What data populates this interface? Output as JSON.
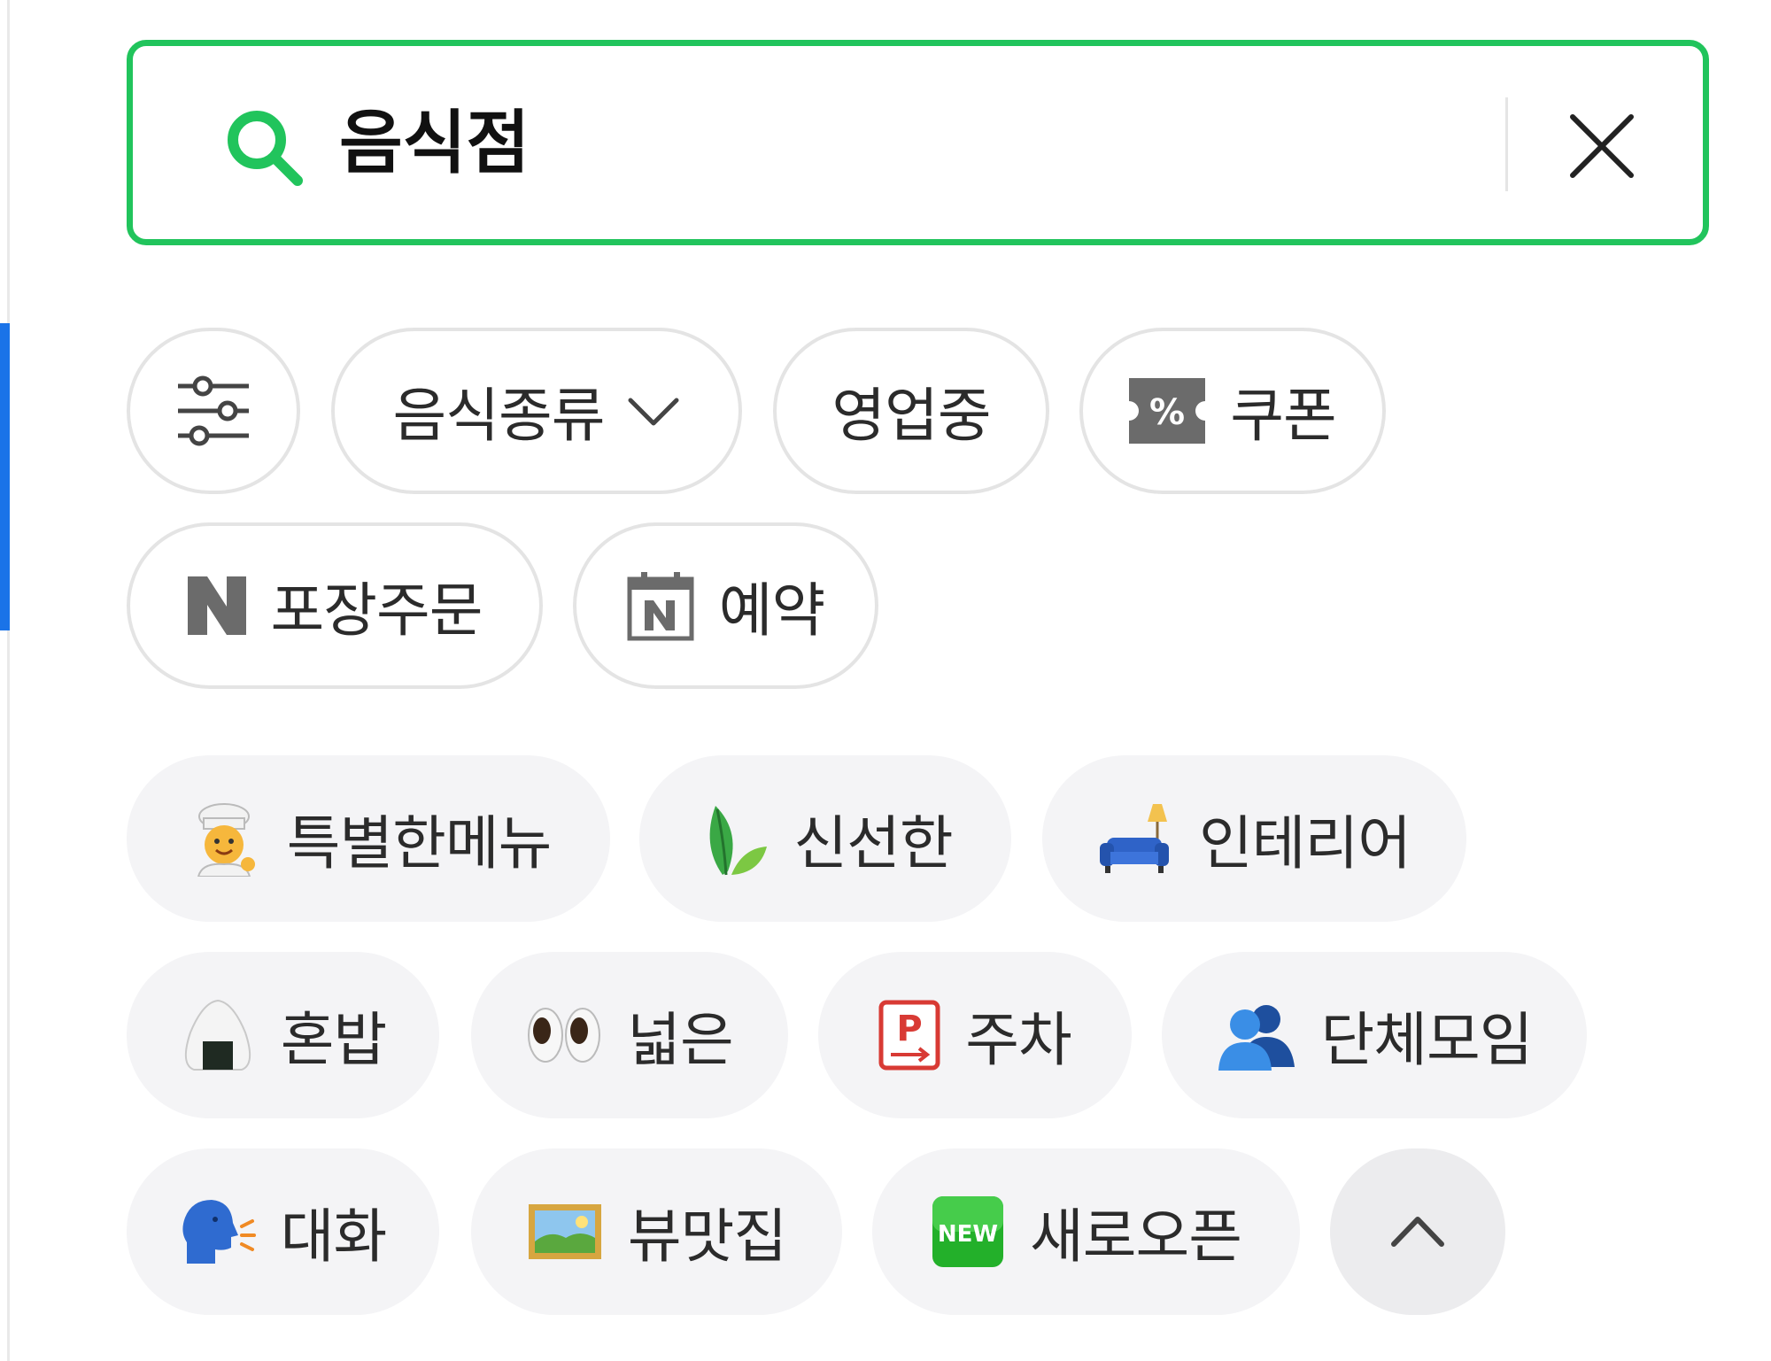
{
  "search": {
    "value": "음식점",
    "placeholder": ""
  },
  "filters": [
    {
      "label": "",
      "icon": "sliders-icon"
    },
    {
      "label": "음식종류",
      "icon": "chevron-down-icon"
    },
    {
      "label": "영업중"
    },
    {
      "label": "쿠폰",
      "icon": "coupon-percent-icon"
    },
    {
      "label": "포장주문",
      "icon": "naver-n-icon"
    },
    {
      "label": "예약",
      "icon": "calendar-n-icon"
    }
  ],
  "tags": [
    {
      "label": "특별한메뉴",
      "icon": "chef-icon"
    },
    {
      "label": "신선한",
      "icon": "leaf-icon"
    },
    {
      "label": "인테리어",
      "icon": "sofa-lamp-icon"
    },
    {
      "label": "혼밥",
      "icon": "rice-ball-icon"
    },
    {
      "label": "넓은",
      "icon": "eyes-icon"
    },
    {
      "label": "주차",
      "icon": "parking-icon"
    },
    {
      "label": "단체모임",
      "icon": "people-icon"
    },
    {
      "label": "대화",
      "icon": "speaking-head-icon"
    },
    {
      "label": "뷰맛집",
      "icon": "landscape-picture-icon"
    },
    {
      "label": "새로오픈",
      "icon": "new-badge-icon"
    }
  ],
  "colors": {
    "accent": "#21c45c",
    "side_accent": "#1a73e8",
    "chip_border": "#e4e4e4",
    "chip_fill": "#f4f4f6"
  }
}
